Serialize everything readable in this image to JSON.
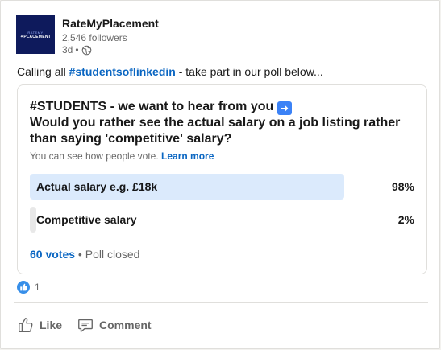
{
  "author": {
    "logo_line1": "RATEMY",
    "logo_line2": "✦PLACEMENT",
    "name": "RateMyPlacement",
    "followers": "2,546 followers",
    "time": "3d",
    "separator": "•"
  },
  "post": {
    "text_before": "Calling all ",
    "hashtag": "#studentsoflinkedin",
    "text_after": " - take part in our poll below..."
  },
  "poll": {
    "question_line1": "#STUDENTS - we want to hear from you",
    "question_line2": "Would you rather see the actual salary on a job listing rather than saying 'competitive' salary?",
    "visibility_text": "You can see how people vote.",
    "learn_more": "Learn more",
    "options": [
      {
        "label": "Actual salary e.g. £18k",
        "percent": "98%",
        "fraction": 0.98,
        "selected": true
      },
      {
        "label": "Competitive salary",
        "percent": "2%",
        "fraction": 0.02,
        "selected": false
      }
    ],
    "votes": "60 votes",
    "footer_sep": " • ",
    "status": "Poll closed"
  },
  "reactions": {
    "count": "1"
  },
  "actions": {
    "like": "Like",
    "comment": "Comment"
  },
  "colors": {
    "link_blue": "#0a66c2",
    "selected_fill": "#dbeafc",
    "unselected_fill": "#e8e8e8"
  }
}
